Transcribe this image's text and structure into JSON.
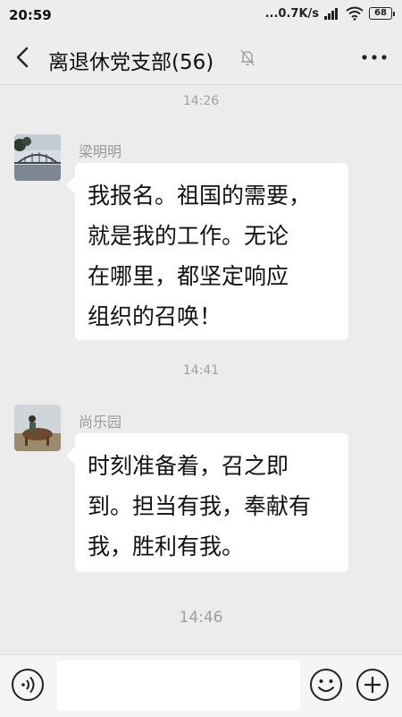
{
  "status_bar": {
    "time": "20:59",
    "net_speed": "...0.7K/s",
    "battery": "68"
  },
  "header": {
    "title": "离退休党支部(56)",
    "back_icon": "chevron-left-icon",
    "mute_icon": "bell-muted-icon",
    "more_icon": "ellipsis-icon"
  },
  "messages": [
    {
      "type": "time",
      "text": "14:26"
    },
    {
      "type": "message",
      "sender": "梁明明",
      "lines": [
        "我报名。祖国的需要，",
        "就是我的工作。无论",
        "在哪里，都坚定响应",
        "组织的召唤！"
      ]
    },
    {
      "type": "time",
      "text": "14:41"
    },
    {
      "type": "message",
      "sender": "尚乐园",
      "lines": [
        "时刻准备着，召之即",
        "到。担当有我，奉献有",
        "我，胜利有我。"
      ]
    },
    {
      "type": "time",
      "text": "14:46"
    }
  ],
  "input_bar": {
    "voice_icon": "voice-icon",
    "emoji_icon": "emoji-icon",
    "plus_icon": "plus-icon",
    "text_value": ""
  }
}
